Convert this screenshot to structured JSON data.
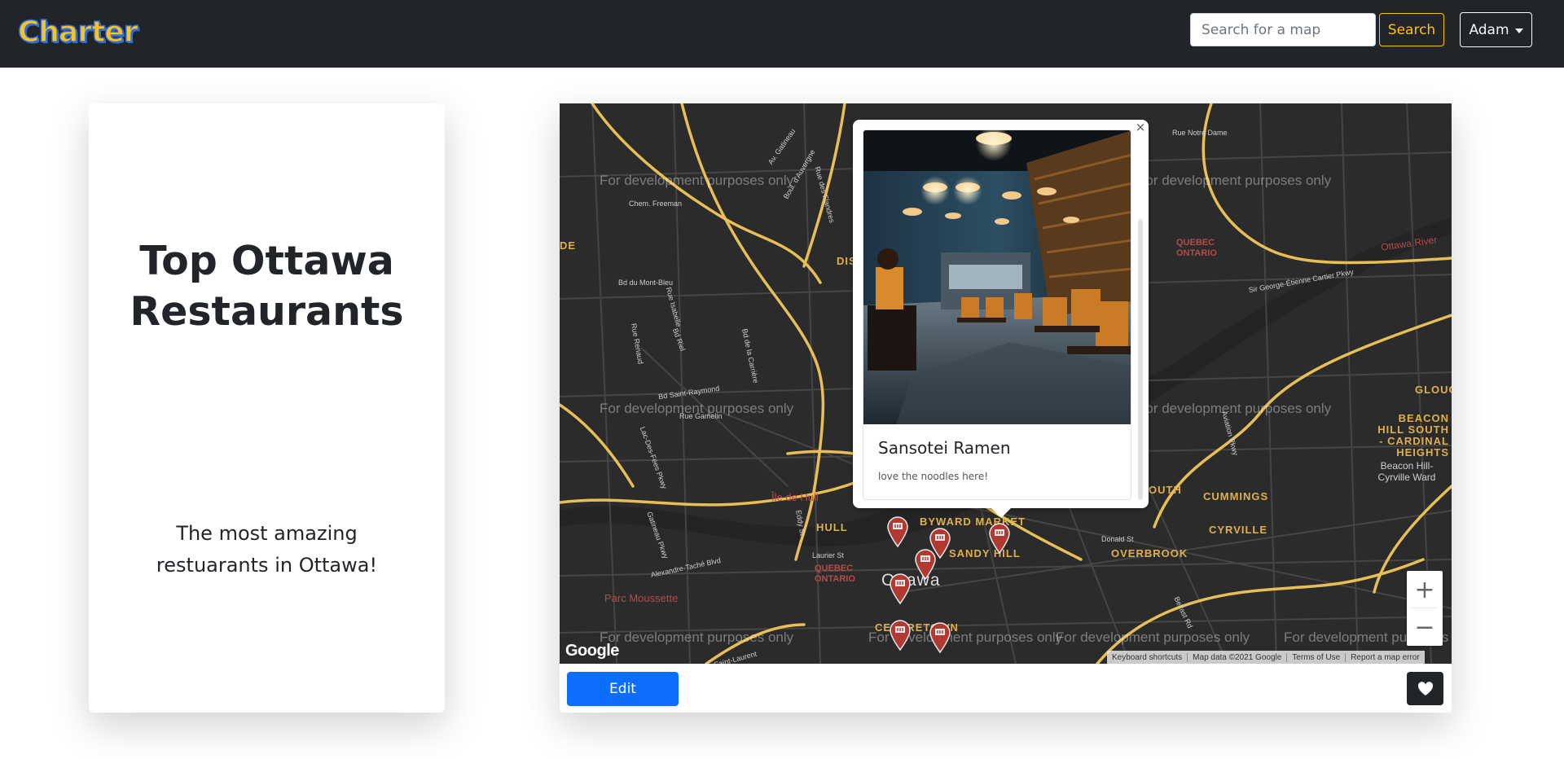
{
  "brand": {
    "name": "Charter"
  },
  "navbar": {
    "search_placeholder": "Search for a map",
    "search_label": "Search",
    "user_label": "Adam"
  },
  "map_info": {
    "title": "Top Ottawa Restaurants",
    "description": "The most amazing restuarants in Ottawa!"
  },
  "map": {
    "dev_watermark": "For development purposes only",
    "google_logo": "Google",
    "attribution": [
      "Keyboard shortcuts",
      "Map data ©2021 Google",
      "Terms of Use",
      "Report a map error"
    ],
    "zoom_in": "+",
    "zoom_out": "−",
    "street_labels": [
      "Rue Notre Dame",
      "Av. Gatineau",
      "Boul. d'Auvergne",
      "Rue des Flandres",
      "Chem. Freeman",
      "Bd du Mont-Bleu",
      "Rue Isabelle",
      "Rue Renaud",
      "Bd Riel",
      "Bd de la Carrière",
      "Bd Saint-Raymond",
      "Rue Gamelin",
      "Lac-Des-Fées Pkwy",
      "Gatineau Pkwy",
      "Alexandre-Taché Blvd",
      "Laurier St",
      "Eddy St",
      "Sir George-Étienne Cartier Pkwy",
      "Donald St",
      "Aviation Pkwy",
      "Belfast Rd",
      "Rue Saint-Laurent"
    ],
    "area_labels": [
      "BYWARD MARKET",
      "SANDY HILL",
      "HULL",
      "OUTH",
      "CUMMINGS",
      "CYRVILLE",
      "OVERBROOK",
      "CENTRETOWN",
      "GLOUC",
      "BEACON HILL SOUTH - CARDINAL HEIGHTS",
      "DIS",
      "DE"
    ],
    "region_labels": [
      "QUEBEC ONTARIO",
      "Ottawa River",
      "Île de Hull",
      "Parc Moussette"
    ],
    "town_labels": [
      "Ottawa",
      "Beacon Hill-Cyrville Ward"
    ],
    "icons": {
      "marker": "restaurant-marker-icon",
      "close": "close-icon",
      "heart": "heart-icon"
    },
    "colors": {
      "background": "#2b2b2b",
      "highway": "#e8bf57",
      "road": "#4a4a4a",
      "marker": "#c0392b"
    }
  },
  "info_window": {
    "close_symbol": "×",
    "place_name": "Sansotei Ramen",
    "place_description": "love the noodles here!"
  },
  "footer": {
    "edit_label": "Edit"
  }
}
